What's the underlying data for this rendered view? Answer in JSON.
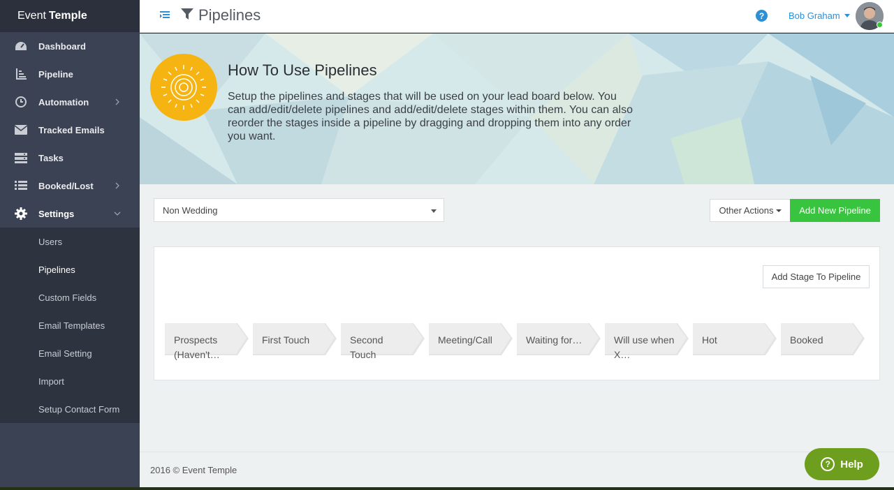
{
  "app": {
    "brand_first": "Event",
    "brand_second": "Temple"
  },
  "sidebar": {
    "items": [
      {
        "label": "Dashboard",
        "icon": "dashboard-icon"
      },
      {
        "label": "Pipeline",
        "icon": "pipeline-icon"
      },
      {
        "label": "Automation",
        "icon": "clock-icon",
        "has_chevron": true
      },
      {
        "label": "Tracked Emails",
        "icon": "envelope-icon"
      },
      {
        "label": "Tasks",
        "icon": "tasks-icon"
      },
      {
        "label": "Booked/Lost",
        "icon": "list-icon",
        "has_chevron": true
      },
      {
        "label": "Settings",
        "icon": "gear-icon",
        "expanded": true
      }
    ],
    "settings_sub": [
      "Users",
      "Pipelines",
      "Custom Fields",
      "Email Templates",
      "Email Setting",
      "Import",
      "Setup Contact Form"
    ],
    "active_sub": "Pipelines"
  },
  "header": {
    "title": "Pipelines",
    "user_name": "Bob Graham",
    "help_icon": "?"
  },
  "banner": {
    "title": "How To Use Pipelines",
    "text": "Setup the pipelines and stages that will be used on your lead board below. You can add/edit/delete pipelines and add/edit/delete stages within them. You can also reorder the stages inside a pipeline by dragging and dropping them into any order you want."
  },
  "controls": {
    "pipeline_selected": "Non Wedding",
    "other_actions": "Other Actions",
    "add_pipeline": "Add New Pipeline"
  },
  "panel": {
    "add_stage": "Add Stage To Pipeline",
    "stages": [
      "Prospects (Haven't…",
      "First Touch",
      "Second Touch",
      "Meeting/Call",
      "Waiting for…",
      "Will use when X…",
      "Hot",
      "Booked"
    ]
  },
  "footer": {
    "text": "2016 © Event Temple",
    "help_label": "Help"
  },
  "colors": {
    "sidebar": "#3b4254",
    "accent_blue": "#2d8fd5",
    "add_green": "#39c43f",
    "help_green": "#6e9e1d",
    "sun": "#f6b412"
  }
}
